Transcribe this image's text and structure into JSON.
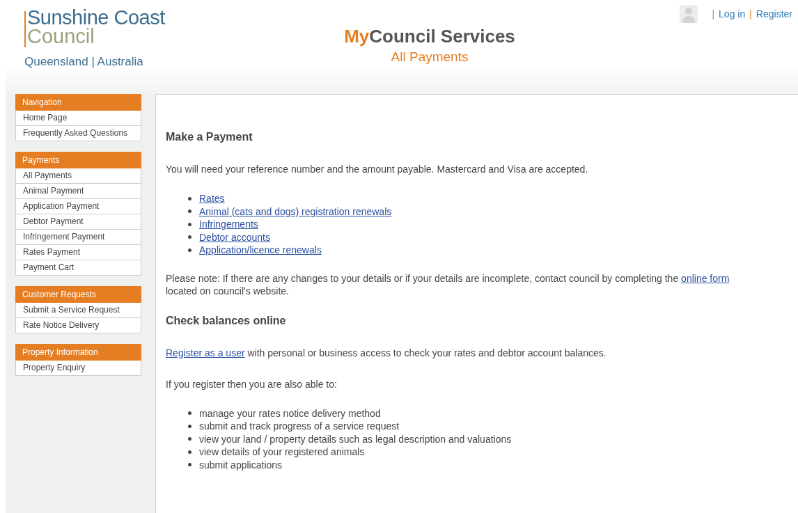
{
  "logo": {
    "line_1": "Sunshine Coast",
    "line_2": "Council",
    "tagline": "Queensland | Australia"
  },
  "header": {
    "title_accent": "My",
    "title_rest": "Council Services",
    "subtitle": "All Payments"
  },
  "account_links": {
    "separator_1": "|",
    "login": "Log in",
    "separator_2": "|",
    "register": "Register"
  },
  "sidebar": [
    {
      "heading": "Navigation",
      "items": [
        "Home Page",
        "Frequently Asked Questions"
      ]
    },
    {
      "heading": "Payments",
      "items": [
        "All Payments",
        "Animal Payment",
        "Application Payment",
        "Debtor Payment",
        "Infringement Payment",
        "Rates Payment",
        "Payment Cart"
      ]
    },
    {
      "heading": "Customer Requests",
      "items": [
        "Submit a Service Request",
        "Rate Notice Delivery"
      ]
    },
    {
      "heading": "Property Information",
      "items": [
        "Property Enquiry"
      ]
    }
  ],
  "content": {
    "heading_1": "Make a Payment",
    "intro": "You will need your reference number and the amount payable. Mastercard and Visa are accepted.",
    "payment_links": [
      "Rates",
      "Animal (cats and dogs) registration renewals",
      "Infringements",
      "Debtor accounts",
      "Application/licence renewals"
    ],
    "note": {
      "before": "Please note: If there are any changes to your details or if your details are incomplete, contact council by completing the",
      "link": "online form",
      "after": "located on council's website."
    },
    "heading_2": "Check balances online",
    "register": {
      "link": "Register as a user",
      "after": "with personal or business access to check your rates and debtor account balances."
    },
    "also_intro": "If you register then you are also able to:",
    "benefits": [
      "manage your rates notice delivery method",
      "submit and track progress of a service request",
      "view your land / property details such as legal description and valuations",
      "view details of your registered animals",
      "submit applications"
    ]
  }
}
